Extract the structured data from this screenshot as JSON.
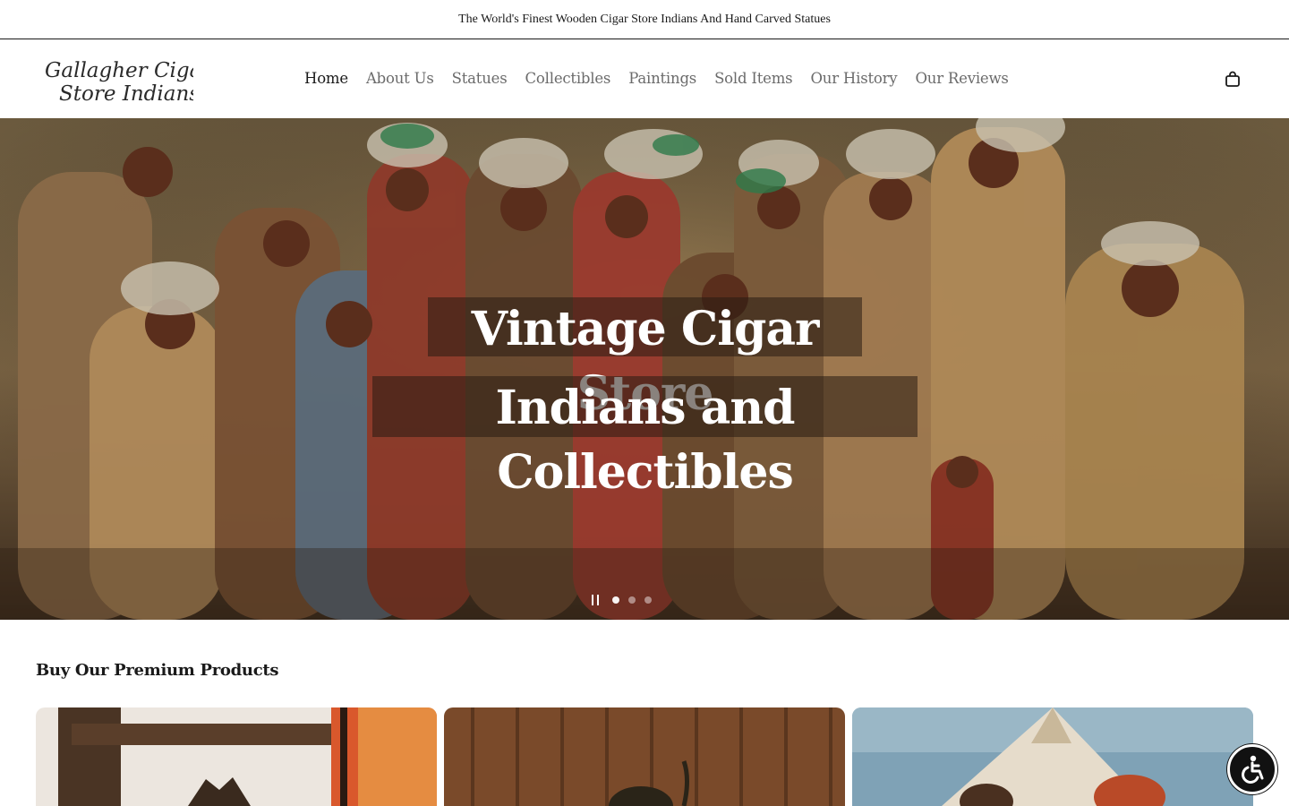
{
  "announcement": {
    "text": "The World's Finest Wooden Cigar Store Indians And Hand Carved Statues"
  },
  "header": {
    "logo_line1": "Gallagher Cigar",
    "logo_line2": "Store Indians",
    "nav": [
      {
        "label": "Home",
        "active": true
      },
      {
        "label": "About Us",
        "active": false
      },
      {
        "label": "Statues",
        "active": false
      },
      {
        "label": "Collectibles",
        "active": false
      },
      {
        "label": "Paintings",
        "active": false
      },
      {
        "label": "Sold Items",
        "active": false
      },
      {
        "label": "Our History",
        "active": false
      },
      {
        "label": "Our Reviews",
        "active": false
      }
    ],
    "cart_icon": "shopping-bag-icon"
  },
  "hero": {
    "title_line1": "Vintage Cigar Store",
    "title_line2": "Indians and Collectibles",
    "slides_total": 3,
    "active_slide": 1,
    "pause_icon": "pause-icon"
  },
  "products": {
    "section_title": "Buy Our Premium Products"
  },
  "accessibility": {
    "icon": "wheelchair-icon"
  },
  "colors": {
    "text": "#1a1a1a",
    "nav_muted": "#6b6b6b",
    "a11y_bg": "#111111"
  }
}
